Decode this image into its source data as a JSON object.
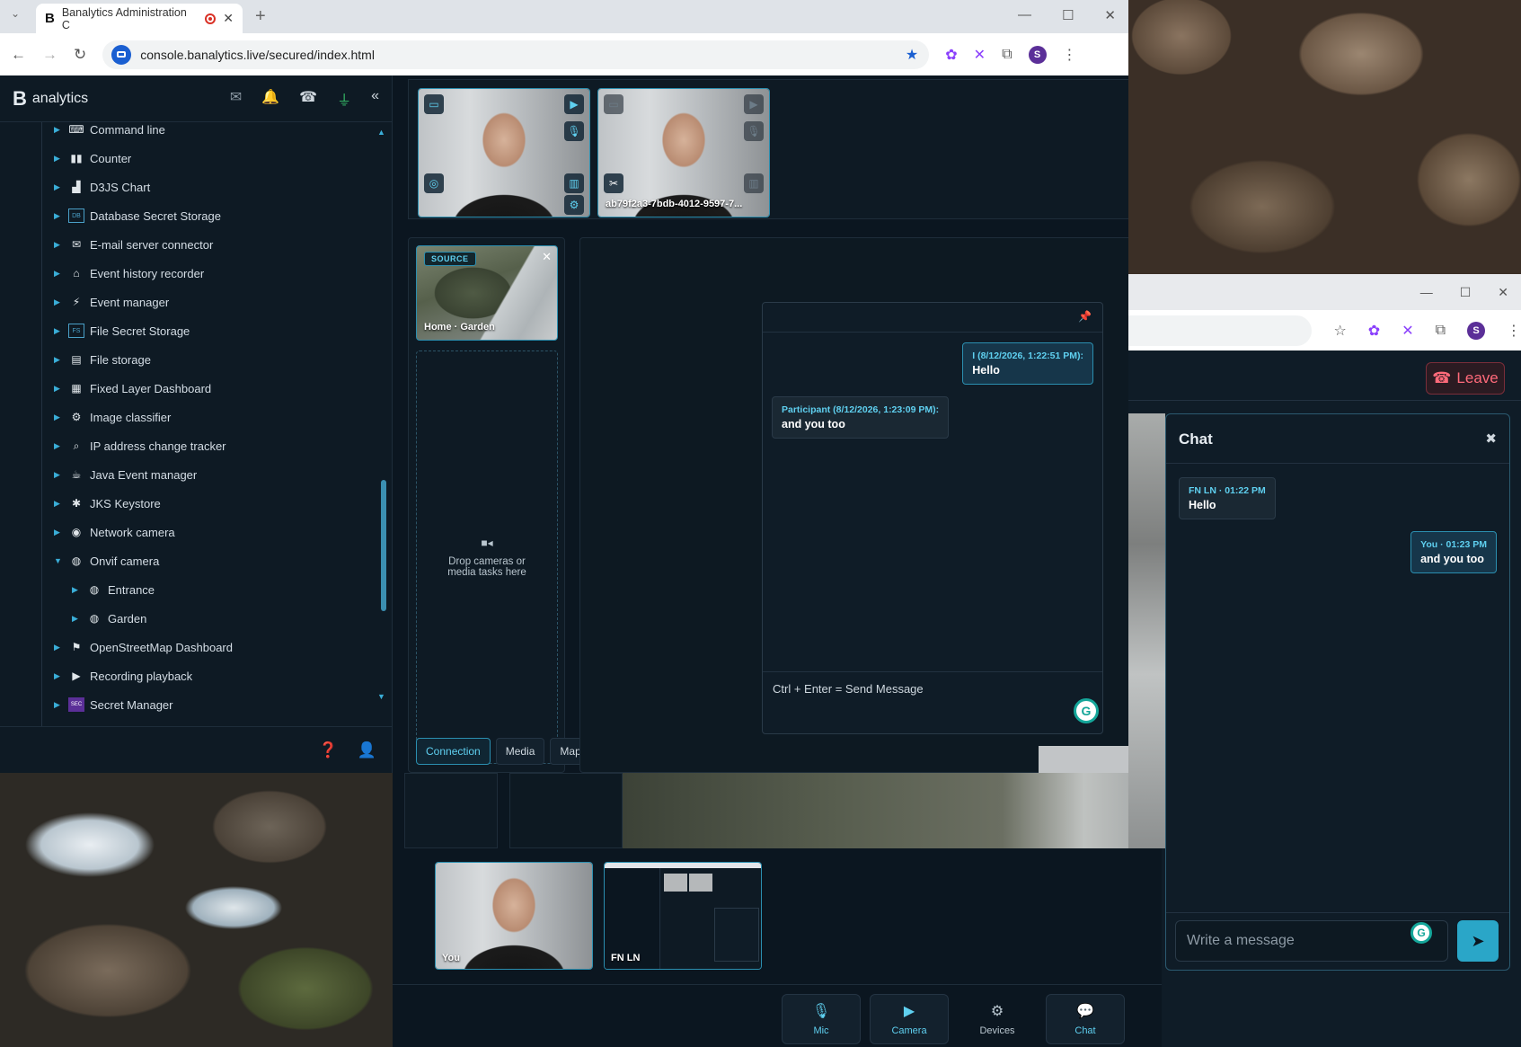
{
  "browser": {
    "tab_title": "Banalytics Administration C",
    "url": "console.banalytics.live/secured/index.html",
    "profile_initial": "S"
  },
  "sidebar": {
    "logo_letter": "B",
    "logo_text": "analytics",
    "tree_items": [
      {
        "label": "Command line",
        "icon": "terminal-icon",
        "glyph": "⌨",
        "expanded": false,
        "level": 0
      },
      {
        "label": "Counter",
        "icon": "counter-icon",
        "glyph": "▮▮",
        "expanded": false,
        "level": 0
      },
      {
        "label": "D3JS Chart",
        "icon": "chart-icon",
        "glyph": "▟",
        "expanded": false,
        "level": 0
      },
      {
        "label": "Database Secret Storage",
        "icon": "db-secret-icon",
        "glyph": "DB",
        "expanded": false,
        "level": 0
      },
      {
        "label": "E-mail server connector",
        "icon": "email-server-icon",
        "glyph": "✉",
        "expanded": false,
        "level": 0
      },
      {
        "label": "Event history recorder",
        "icon": "history-icon",
        "glyph": "⌂",
        "expanded": false,
        "level": 0
      },
      {
        "label": "Event manager",
        "icon": "event-manager-icon",
        "glyph": "⚡",
        "expanded": false,
        "level": 0
      },
      {
        "label": "File Secret Storage",
        "icon": "file-secret-icon",
        "glyph": "FS",
        "expanded": false,
        "level": 0
      },
      {
        "label": "File storage",
        "icon": "file-storage-icon",
        "glyph": "▤",
        "expanded": false,
        "level": 0
      },
      {
        "label": "Fixed Layer Dashboard",
        "icon": "grid-icon",
        "glyph": "▦",
        "expanded": false,
        "level": 0
      },
      {
        "label": "Image classifier",
        "icon": "classifier-icon",
        "glyph": "⚙",
        "expanded": false,
        "level": 0
      },
      {
        "label": "IP address change tracker",
        "icon": "magnifier-icon",
        "glyph": "⌕",
        "expanded": false,
        "level": 0
      },
      {
        "label": "Java Event manager",
        "icon": "java-icon",
        "glyph": "☕",
        "expanded": false,
        "level": 0
      },
      {
        "label": "JKS Keystore",
        "icon": "keystore-icon",
        "glyph": "✱",
        "expanded": false,
        "level": 0
      },
      {
        "label": "Network camera",
        "icon": "network-camera-icon",
        "glyph": "◉",
        "expanded": false,
        "level": 0
      },
      {
        "label": "Onvif camera",
        "icon": "onvif-camera-icon",
        "glyph": "◍",
        "expanded": true,
        "level": 0
      },
      {
        "label": "Entrance",
        "icon": "camera-icon",
        "glyph": "◍",
        "expanded": false,
        "level": 1
      },
      {
        "label": "Garden",
        "icon": "camera-icon",
        "glyph": "◍",
        "expanded": false,
        "level": 1
      },
      {
        "label": "OpenStreetMap Dashboard",
        "icon": "map-icon",
        "glyph": "⚑",
        "expanded": false,
        "level": 0
      },
      {
        "label": "Recording playback",
        "icon": "playback-icon",
        "glyph": "▶",
        "expanded": false,
        "level": 0
      },
      {
        "label": "Secret Manager",
        "icon": "secret-manager-icon",
        "glyph": "SEC",
        "expanded": false,
        "level": 0
      }
    ]
  },
  "camera_strip": {
    "tile2_caption": "ab79f2a3-7bdb-4012-9597-7..."
  },
  "source_panel": {
    "badge": "SOURCE",
    "caption": "Home · Garden",
    "drop_hint": "Drop cameras or media tasks here",
    "tabs": [
      "Connection",
      "Media",
      "Map"
    ]
  },
  "chat_popup": {
    "messages": [
      {
        "meta": "I (8/12/2026, 1:22:51 PM):",
        "text": "Hello"
      },
      {
        "meta": "Participant (8/12/2026, 1:23:09 PM):",
        "text": "and you too"
      }
    ],
    "input_placeholder": "Ctrl + Enter = Send Message"
  },
  "meeting": {
    "leave_label": "Leave",
    "thumbs": [
      "You",
      "FN LN"
    ],
    "controls": [
      "Mic",
      "Camera",
      "Devices",
      "Chat"
    ],
    "chat": {
      "title": "Chat",
      "messages": [
        {
          "meta": "FN LN · 01:22 PM",
          "text": "Hello"
        },
        {
          "meta": "You · 01:23 PM",
          "text": "and you too"
        }
      ],
      "placeholder": "Write a message"
    }
  },
  "colors": {
    "accent": "#5fd0f0",
    "panel": "#0e1a24",
    "leave": "#ff6a7a"
  }
}
